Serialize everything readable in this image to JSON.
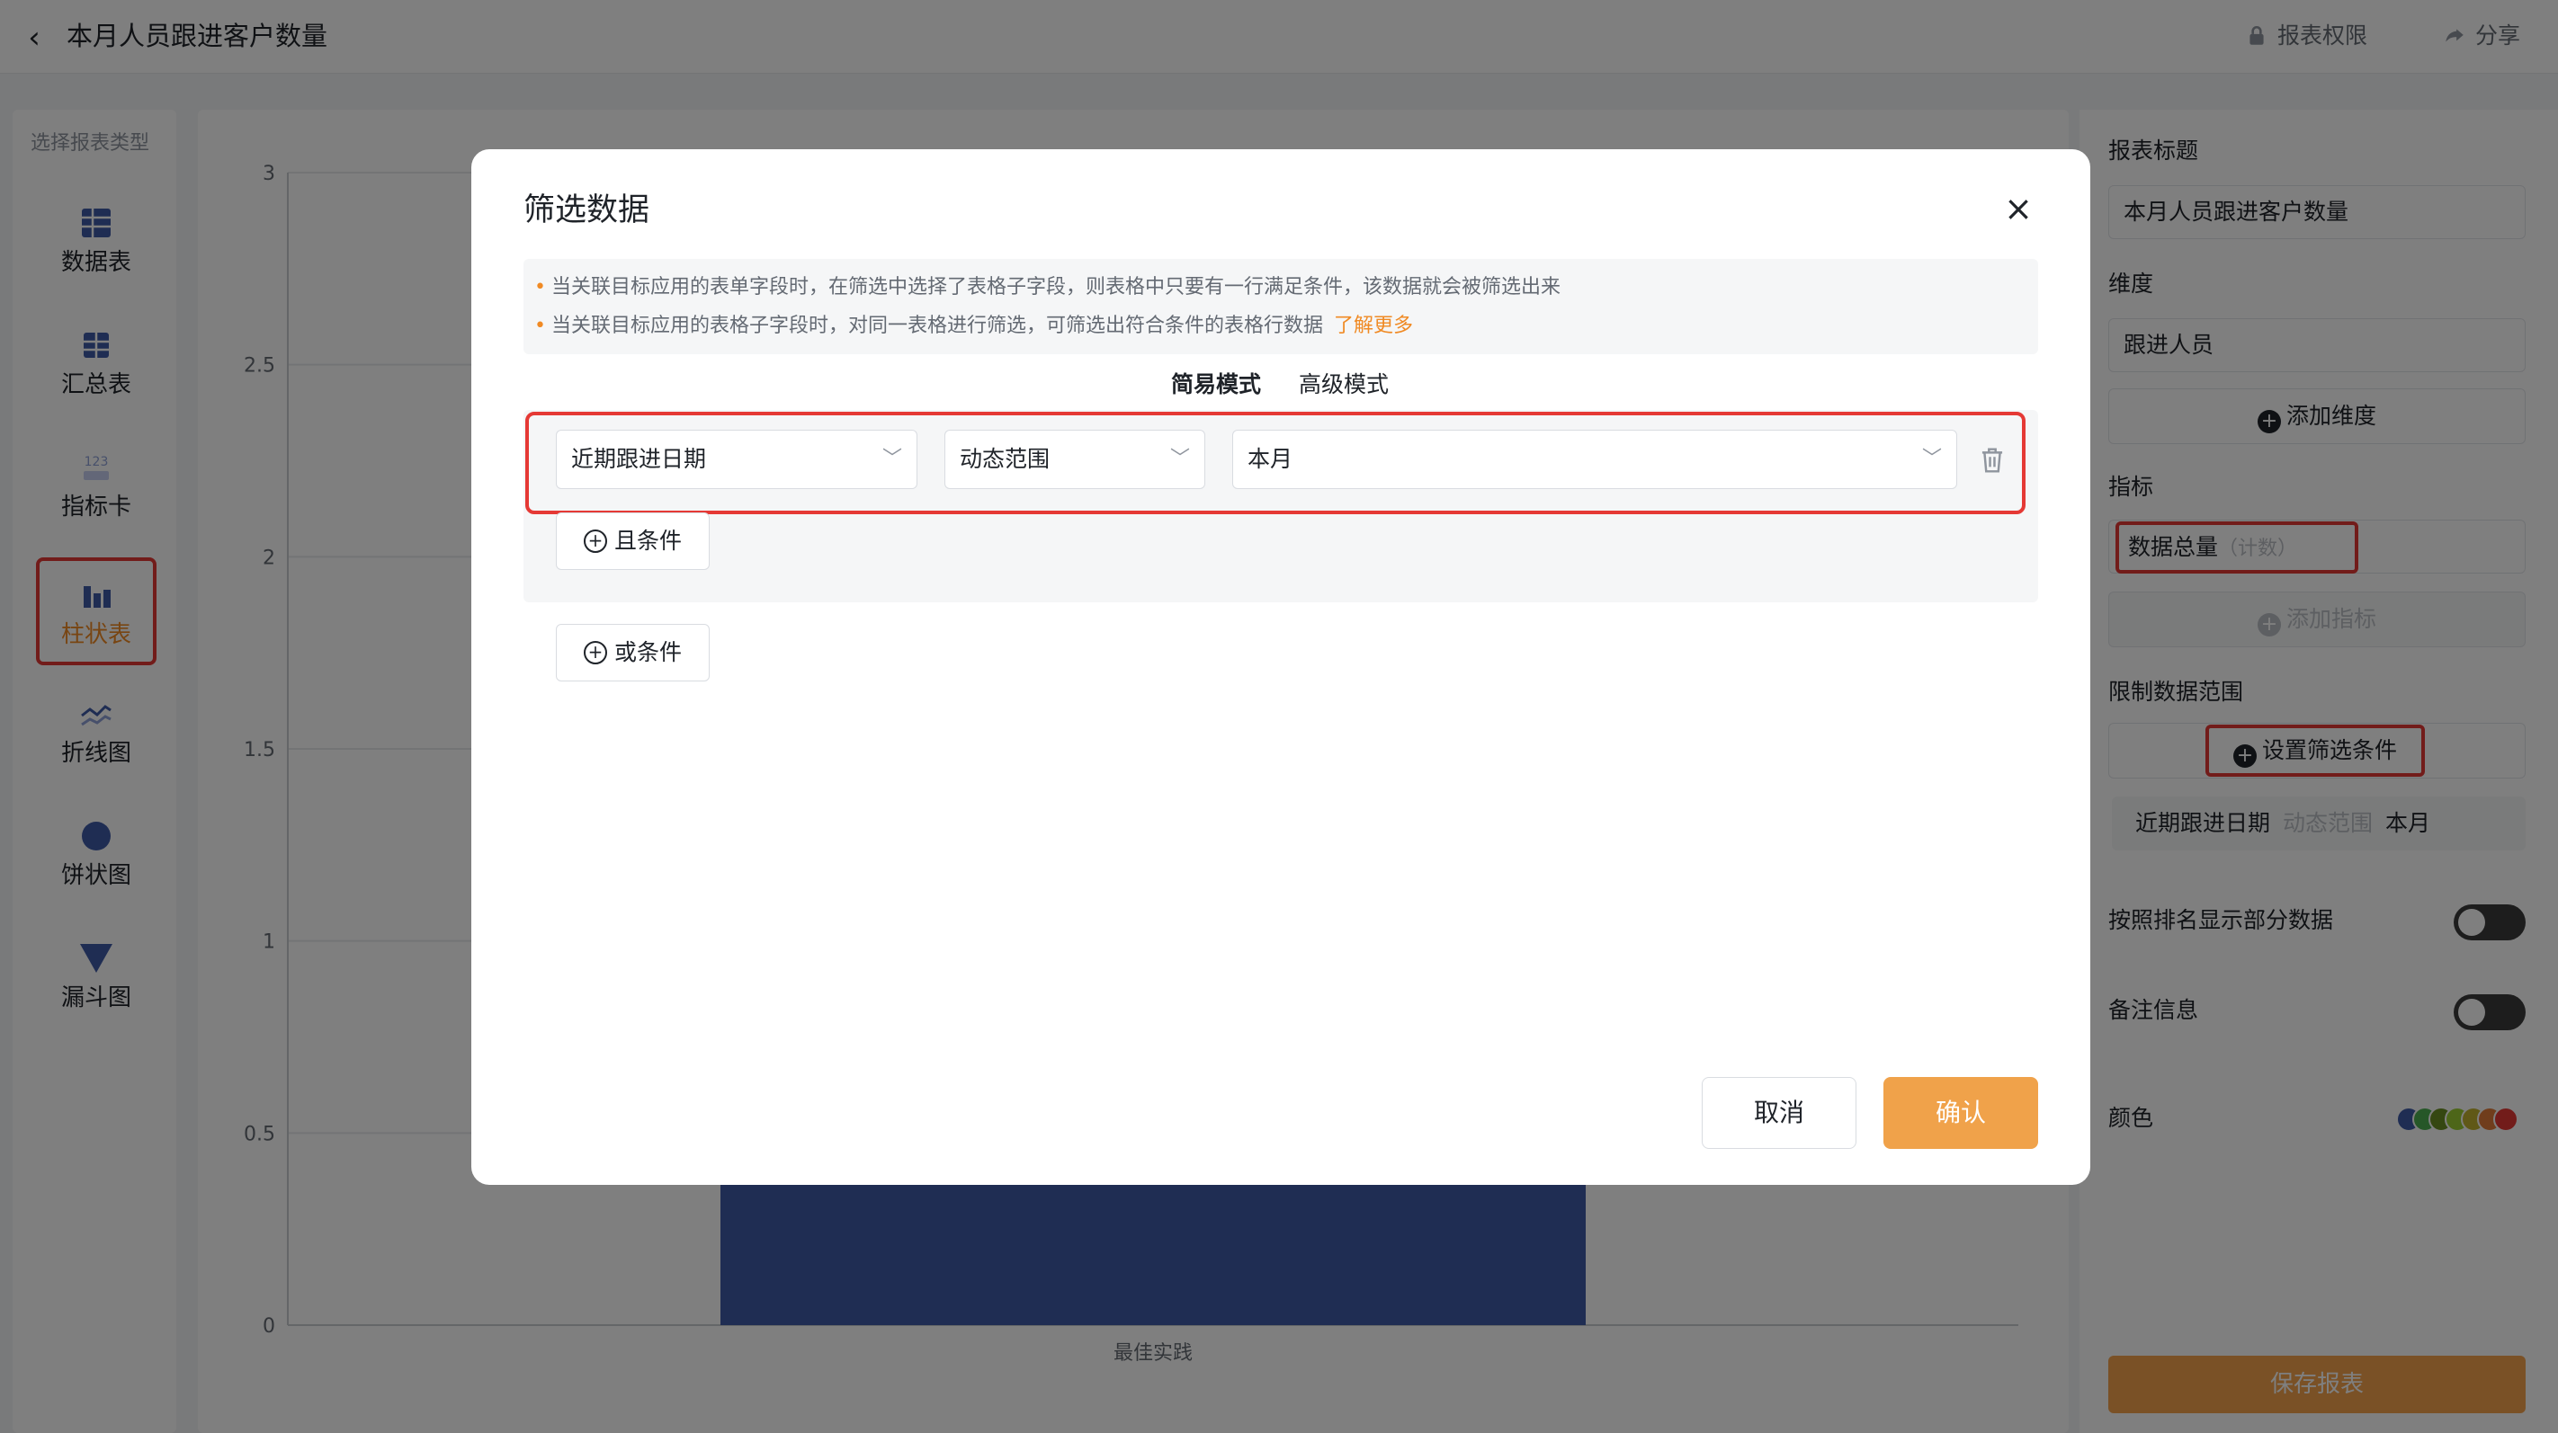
{
  "header": {
    "title": "本月人员跟进客户数量",
    "permission_label": "报表权限",
    "share_label": "分享"
  },
  "left_panel": {
    "caption": "选择报表类型",
    "types": [
      {
        "label": "数据表",
        "icon": "table-icon"
      },
      {
        "label": "汇总表",
        "icon": "summary-table-icon"
      },
      {
        "label": "指标卡",
        "icon": "metric-card-icon"
      },
      {
        "label": "柱状表",
        "icon": "bar-chart-icon",
        "selected": true
      },
      {
        "label": "折线图",
        "icon": "line-chart-icon"
      },
      {
        "label": "饼状图",
        "icon": "pie-chart-icon"
      },
      {
        "label": "漏斗图",
        "icon": "funnel-chart-icon"
      }
    ]
  },
  "chart_data": {
    "type": "bar",
    "categories": [
      "最佳实践"
    ],
    "values": [
      2
    ],
    "ylim": [
      0,
      3
    ],
    "yticks": [
      "0",
      "0.5",
      "1",
      "1.5",
      "2",
      "2.5",
      "3"
    ],
    "bar_color": "#3f5aa7",
    "grid": true
  },
  "right_panel": {
    "title_label": "报表标题",
    "title_value": "本月人员跟进客户数量",
    "dimension_label": "维度",
    "dimension_value": "跟进人员",
    "add_dimension": "添加维度",
    "metric_label": "指标",
    "metric_value": "数据总量",
    "metric_sub": "（计数）",
    "add_metric": "添加指标",
    "range_label": "限制数据范围",
    "set_filter": "设置筛选条件",
    "filter_summary": {
      "field": "近期跟进日期",
      "op": "动态范围",
      "value": "本月"
    },
    "rank_label": "按照排名显示部分数据",
    "note_label": "备注信息",
    "color_label": "颜色",
    "palette": [
      "#3f5aa7",
      "#4caf50",
      "#6b8e23",
      "#9acd32",
      "#c0b02e",
      "#e07b39",
      "#e53935"
    ],
    "save_label": "保存报表"
  },
  "modal": {
    "title": "筛选数据",
    "notices": [
      "当关联目标应用的表单字段时，在筛选中选择了表格子字段，则表格中只要有一行满足条件，该数据就会被筛选出来",
      "当关联目标应用的表格子字段时，对同一表格进行筛选，可筛选出符合条件的表格行数据"
    ],
    "learn_more": "了解更多",
    "mode_simple": "简易模式",
    "mode_advanced": "高级模式",
    "condition": {
      "field": "近期跟进日期",
      "operator": "动态范围",
      "value": "本月"
    },
    "and_label": "且条件",
    "or_label": "或条件",
    "cancel_label": "取消",
    "confirm_label": "确认"
  },
  "colors": {
    "accent": "#f0a24a",
    "highlight": "#e53935"
  }
}
